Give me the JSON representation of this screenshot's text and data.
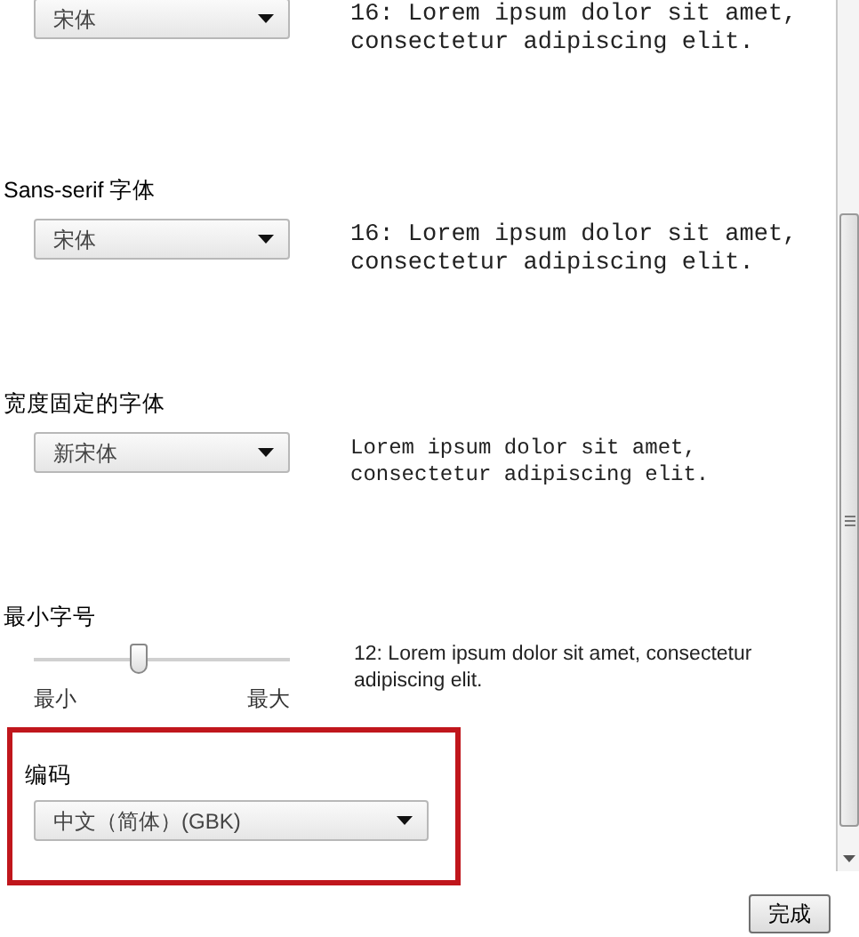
{
  "sections": [
    {
      "kind": "font",
      "value": "宋体",
      "sample": {
        "kind": "serif",
        "text": "16: Lorem ipsum dolor sit amet, consectetur adipiscing elit."
      }
    },
    {
      "kind": "font",
      "heading": "Sans-serif 字体",
      "value": "宋体",
      "sample": {
        "kind": "serif",
        "text": "16: Lorem ipsum dolor sit amet, consectetur adipiscing elit."
      }
    },
    {
      "kind": "font",
      "heading": "宽度固定的字体",
      "value": "新宋体",
      "sample": {
        "kind": "fixed",
        "text": "Lorem ipsum dolor sit amet, consectetur adipiscing elit."
      }
    },
    {
      "kind": "slider",
      "heading": "最小字号",
      "level": 0.41,
      "min_label": "最小",
      "max_label": "最大",
      "sample": {
        "kind": "sans",
        "text": "12: Lorem ipsum dolor sit amet, consectetur adipiscing elit."
      }
    },
    {
      "kind": "encoding",
      "heading": "编码",
      "value": "中文（简体）(GBK)"
    }
  ],
  "done_button": "完成"
}
